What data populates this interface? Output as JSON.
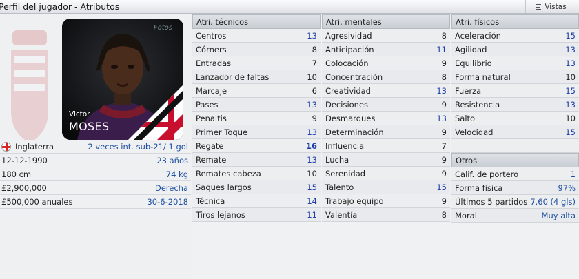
{
  "header": {
    "title": "Perfil del jugador - Atributos",
    "views_label": "Vistas"
  },
  "player": {
    "first_name": "Victor",
    "last_name": "MOSES",
    "photo_label": "Fotos"
  },
  "info": [
    {
      "label": "Inglaterra",
      "value": "2 veces int. sub-21/ 1 gol",
      "flag": true
    },
    {
      "label": "12-12-1990",
      "value": "23 años"
    },
    {
      "label": "180 cm",
      "value": "74 kg"
    },
    {
      "label": "£2,900,000",
      "value": "Derecha"
    },
    {
      "label": "£500,000 anuales",
      "value": "30-6-2018"
    }
  ],
  "technical": {
    "title": "Atri. técnicos",
    "rows": [
      {
        "label": "Centros",
        "value": "13",
        "style": "hi"
      },
      {
        "label": "Córners",
        "value": "8",
        "style": ""
      },
      {
        "label": "Entradas",
        "value": "7",
        "style": ""
      },
      {
        "label": "Lanzador de faltas",
        "value": "10",
        "style": ""
      },
      {
        "label": "Marcaje",
        "value": "6",
        "style": ""
      },
      {
        "label": "Pases",
        "value": "13",
        "style": "hi"
      },
      {
        "label": "Penaltis",
        "value": "9",
        "style": ""
      },
      {
        "label": "Primer Toque",
        "value": "13",
        "style": "hi"
      },
      {
        "label": "Regate",
        "value": "16",
        "style": "b"
      },
      {
        "label": "Remate",
        "value": "13",
        "style": "hi"
      },
      {
        "label": "Remates cabeza",
        "value": "10",
        "style": ""
      },
      {
        "label": "Saques largos",
        "value": "15",
        "style": "hi"
      },
      {
        "label": "Técnica",
        "value": "14",
        "style": "hi"
      },
      {
        "label": "Tiros lejanos",
        "value": "11",
        "style": "hi"
      }
    ]
  },
  "mental": {
    "title": "Atri. mentales",
    "rows": [
      {
        "label": "Agresividad",
        "value": "8",
        "style": ""
      },
      {
        "label": "Anticipación",
        "value": "11",
        "style": "hi"
      },
      {
        "label": "Colocación",
        "value": "9",
        "style": ""
      },
      {
        "label": "Concentración",
        "value": "8",
        "style": ""
      },
      {
        "label": "Creatividad",
        "value": "13",
        "style": "hi"
      },
      {
        "label": "Decisiones",
        "value": "9",
        "style": ""
      },
      {
        "label": "Desmarques",
        "value": "13",
        "style": "hi"
      },
      {
        "label": "Determinación",
        "value": "9",
        "style": ""
      },
      {
        "label": "Influencia",
        "value": "7",
        "style": ""
      },
      {
        "label": "Lucha",
        "value": "9",
        "style": ""
      },
      {
        "label": "Serenidad",
        "value": "9",
        "style": ""
      },
      {
        "label": "Talento",
        "value": "15",
        "style": "hi"
      },
      {
        "label": "Trabajo equipo",
        "value": "9",
        "style": ""
      },
      {
        "label": "Valentía",
        "value": "8",
        "style": ""
      }
    ]
  },
  "physical": {
    "title": "Atri. físicos",
    "rows": [
      {
        "label": "Aceleración",
        "value": "15",
        "style": "hi"
      },
      {
        "label": "Agilidad",
        "value": "13",
        "style": "hi"
      },
      {
        "label": "Equilibrio",
        "value": "13",
        "style": "hi"
      },
      {
        "label": "Forma natural",
        "value": "10",
        "style": ""
      },
      {
        "label": "Fuerza",
        "value": "15",
        "style": "hi"
      },
      {
        "label": "Resistencia",
        "value": "13",
        "style": "hi"
      },
      {
        "label": "Salto",
        "value": "10",
        "style": ""
      },
      {
        "label": "Velocidad",
        "value": "15",
        "style": "hi"
      }
    ]
  },
  "others": {
    "title": "Otros",
    "rows": [
      {
        "label": "Calif. de portero",
        "value": "1"
      },
      {
        "label": "Forma física",
        "value": "97%"
      },
      {
        "label": "Últimos 5 partidos",
        "value": "7.60 (4 gls)"
      },
      {
        "label": "Moral",
        "value": "Muy alta"
      }
    ]
  }
}
